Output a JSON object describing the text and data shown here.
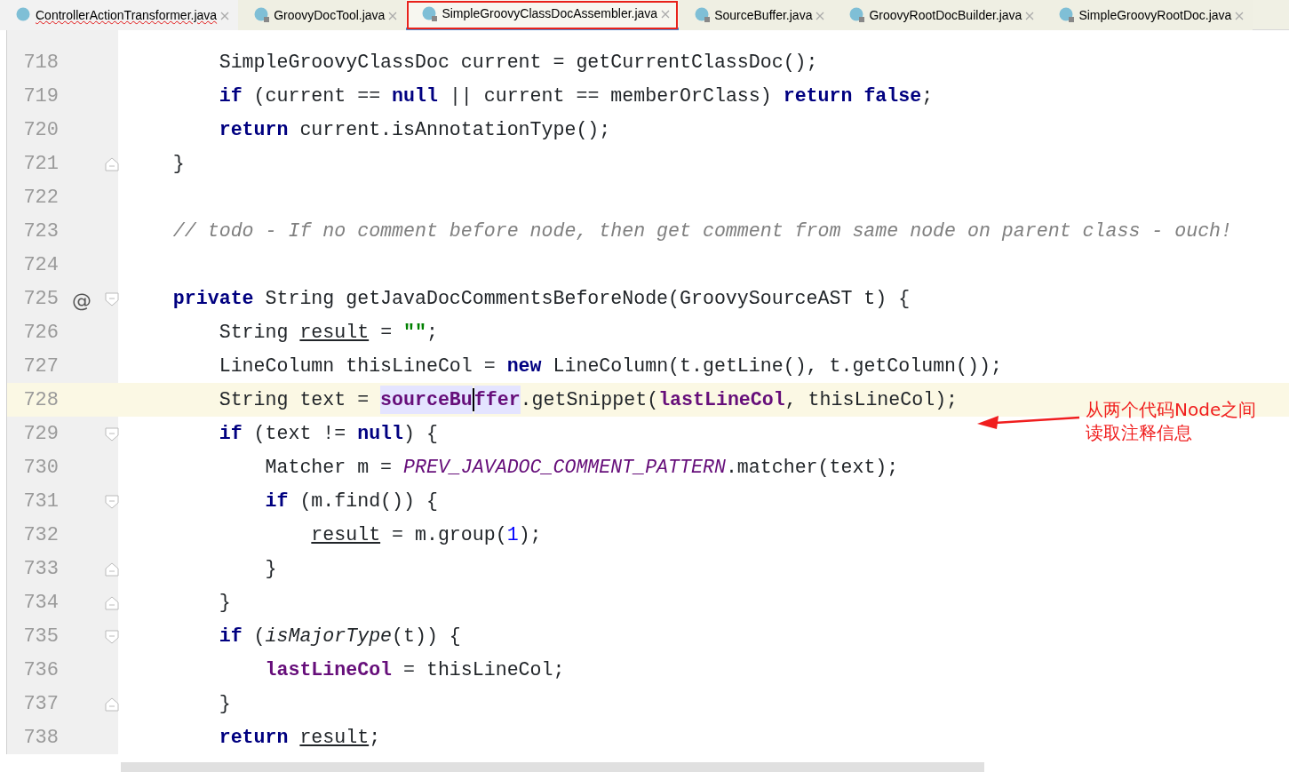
{
  "tabs": [
    {
      "label": "ControllerActionTransformer.java",
      "selected": false,
      "locked": false,
      "error": true
    },
    {
      "label": "GroovyDocTool.java",
      "selected": false,
      "locked": true,
      "error": false
    },
    {
      "label": "SimpleGroovyClassDocAssembler.java",
      "selected": true,
      "locked": true,
      "error": false
    },
    {
      "label": "SourceBuffer.java",
      "selected": false,
      "locked": true,
      "error": false
    },
    {
      "label": "GroovyRootDocBuilder.java",
      "selected": false,
      "locked": true,
      "error": false
    },
    {
      "label": "SimpleGroovyRootDoc.java",
      "selected": false,
      "locked": true,
      "error": false
    }
  ],
  "editor": {
    "lines": [
      {
        "number": "718",
        "current": false,
        "tokens": [
          {
            "kind": "plain",
            "text": "        SimpleGroovyClassDoc current = getCurrentClassDoc();"
          }
        ]
      },
      {
        "number": "719",
        "current": false,
        "tokens": [
          {
            "kind": "keyword",
            "text": "        if"
          },
          {
            "kind": "plain",
            "text": " (current == "
          },
          {
            "kind": "keyword",
            "text": "null"
          },
          {
            "kind": "plain",
            "text": " || current == memberOrClass) "
          },
          {
            "kind": "keyword",
            "text": "return false"
          },
          {
            "kind": "plain",
            "text": ";"
          }
        ]
      },
      {
        "number": "720",
        "current": false,
        "tokens": [
          {
            "kind": "keyword",
            "text": "        return"
          },
          {
            "kind": "plain",
            "text": " current.isAnnotationType();"
          }
        ]
      },
      {
        "number": "721",
        "current": false,
        "fold": {
          "kind": "end"
        },
        "tokens": [
          {
            "kind": "plain",
            "text": "    }"
          }
        ]
      },
      {
        "number": "722",
        "current": false
      },
      {
        "number": "723",
        "current": false,
        "tokens": [
          {
            "kind": "comment",
            "text": "    // todo - If no comment before node, then get comment from same node on parent class - ouch!"
          }
        ]
      },
      {
        "number": "724",
        "current": false
      },
      {
        "number": "725",
        "current": false,
        "fold": {
          "kind": "start"
        },
        "gutter_mark": "@",
        "tokens": [
          {
            "kind": "keyword",
            "text": "    private"
          },
          {
            "kind": "plain",
            "text": " String getJavaDocCommentsBeforeNode(GroovySourceAST t) {"
          }
        ]
      },
      {
        "number": "726",
        "current": false,
        "tokens": [
          {
            "kind": "plain",
            "text": "        String "
          },
          {
            "kind": "reassigned",
            "text": "result"
          },
          {
            "kind": "plain",
            "text": " = "
          },
          {
            "kind": "string",
            "text": "\"\""
          },
          {
            "kind": "plain",
            "text": ";"
          }
        ]
      },
      {
        "number": "727",
        "current": false,
        "tokens": [
          {
            "kind": "plain",
            "text": "        LineColumn thisLineCol = "
          },
          {
            "kind": "keyword",
            "text": "new"
          },
          {
            "kind": "plain",
            "text": " LineColumn(t.getLine(), t.getColumn());"
          }
        ]
      },
      {
        "number": "728",
        "current": true,
        "tokens": [
          {
            "kind": "plain",
            "text": "        String text = "
          },
          {
            "kind": "field-highlighted",
            "text": "sourceBu"
          },
          {
            "kind": "caret"
          },
          {
            "kind": "field-highlighted",
            "text": "ffer"
          },
          {
            "kind": "plain",
            "text": ".getSnippet("
          },
          {
            "kind": "field",
            "text": "lastLineCol"
          },
          {
            "kind": "plain",
            "text": ", thisLineCol);"
          }
        ]
      },
      {
        "number": "729",
        "current": false,
        "fold": {
          "kind": "start"
        },
        "tokens": [
          {
            "kind": "keyword",
            "text": "        if"
          },
          {
            "kind": "plain",
            "text": " (text != "
          },
          {
            "kind": "keyword",
            "text": "null"
          },
          {
            "kind": "plain",
            "text": ") {"
          }
        ]
      },
      {
        "number": "730",
        "current": false,
        "tokens": [
          {
            "kind": "plain",
            "text": "            Matcher m = "
          },
          {
            "kind": "static",
            "text": "PREV_JAVADOC_COMMENT_PATTERN"
          },
          {
            "kind": "plain",
            "text": ".matcher(text);"
          }
        ]
      },
      {
        "number": "731",
        "current": false,
        "fold": {
          "kind": "start"
        },
        "tokens": [
          {
            "kind": "keyword",
            "text": "            if"
          },
          {
            "kind": "plain",
            "text": " (m.find()) {"
          }
        ]
      },
      {
        "number": "732",
        "current": false,
        "tokens": [
          {
            "kind": "reassigned",
            "text": "                result"
          },
          {
            "kind": "plain",
            "text": " = m.group("
          },
          {
            "kind": "number",
            "text": "1"
          },
          {
            "kind": "plain",
            "text": ");"
          }
        ]
      },
      {
        "number": "733",
        "current": false,
        "fold": {
          "kind": "end"
        },
        "tokens": [
          {
            "kind": "plain",
            "text": "            }"
          }
        ]
      },
      {
        "number": "734",
        "current": false,
        "fold": {
          "kind": "end"
        },
        "tokens": [
          {
            "kind": "plain",
            "text": "        }"
          }
        ]
      },
      {
        "number": "735",
        "current": false,
        "fold": {
          "kind": "start"
        },
        "tokens": [
          {
            "kind": "keyword",
            "text": "        if"
          },
          {
            "kind": "plain",
            "text": " ("
          },
          {
            "kind": "method-static",
            "text": "isMajorType"
          },
          {
            "kind": "plain",
            "text": "(t)) {"
          }
        ]
      },
      {
        "number": "736",
        "current": false,
        "tokens": [
          {
            "kind": "field",
            "text": "            lastLineCol"
          },
          {
            "kind": "plain",
            "text": " = thisLineCol;"
          }
        ]
      },
      {
        "number": "737",
        "current": false,
        "fold": {
          "kind": "end"
        },
        "tokens": [
          {
            "kind": "plain",
            "text": "        }"
          }
        ]
      },
      {
        "number": "738",
        "current": false,
        "tokens": [
          {
            "kind": "keyword",
            "text": "        return "
          },
          {
            "kind": "reassigned",
            "text": "result"
          },
          {
            "kind": "plain",
            "text": ";"
          }
        ]
      }
    ]
  },
  "annotation": {
    "lines": [
      "从两个代码Node之间",
      "读取注释信息"
    ]
  }
}
